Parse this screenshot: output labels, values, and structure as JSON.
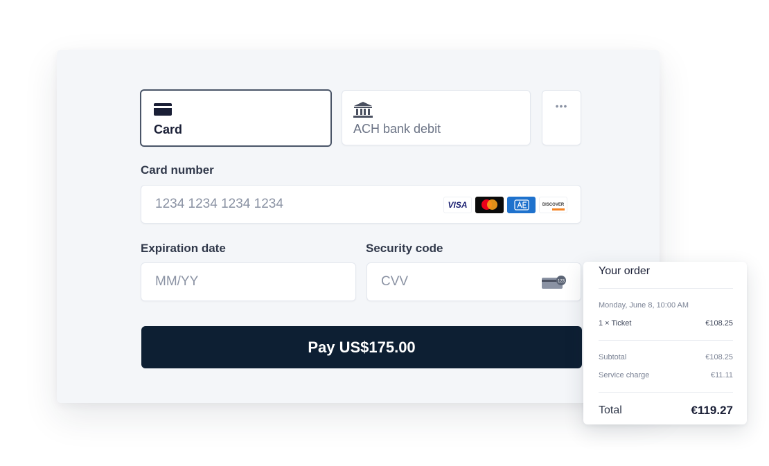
{
  "payment_methods": {
    "card_label": "Card",
    "ach_label": "ACH bank debit",
    "more_label": "•••"
  },
  "form": {
    "card_number_label": "Card number",
    "card_number_placeholder": "1234 1234 1234 1234",
    "expiration_label": "Expiration date",
    "expiration_placeholder": "MM/YY",
    "security_label": "Security code",
    "security_placeholder": "CVV",
    "brands": [
      "VISA",
      "mastercard",
      "amex",
      "DISCOVER"
    ]
  },
  "pay_button_label": "Pay US$175.00",
  "order": {
    "title": "Your order",
    "date": "Monday, June 8, 10:00 AM",
    "item_label": "1 × Ticket",
    "item_price": "€108.25",
    "subtotal_label": "Subtotal",
    "subtotal_value": "€108.25",
    "service_label": "Service charge",
    "service_value": "€11.11",
    "total_label": "Total",
    "total_value": "€119.27"
  },
  "colors": {
    "pay_button": "#0d1f33",
    "panel_bg": "#f4f6f9",
    "selected_border": "#4a5568"
  }
}
